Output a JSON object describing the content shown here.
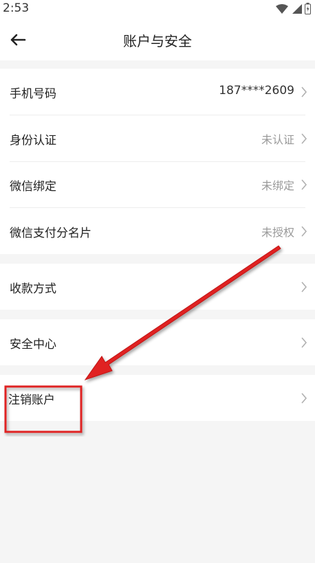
{
  "status_bar": {
    "time": "2:53"
  },
  "header": {
    "title": "账户与安全"
  },
  "groups": [
    {
      "rows": [
        {
          "label": "手机号码",
          "value": "187****2609"
        },
        {
          "label": "身份认证",
          "value": "未认证"
        },
        {
          "label": "微信绑定",
          "value": "未绑定"
        },
        {
          "label": "微信支付分名片",
          "value": "未授权"
        }
      ]
    },
    {
      "rows": [
        {
          "label": "收款方式"
        }
      ]
    },
    {
      "rows": [
        {
          "label": "安全中心"
        }
      ]
    },
    {
      "rows": [
        {
          "label": "注销账户"
        }
      ]
    }
  ],
  "colors": {
    "annotation_red": "#e02020",
    "value_gray": "#999999",
    "chevron": "#b0b0b0"
  }
}
